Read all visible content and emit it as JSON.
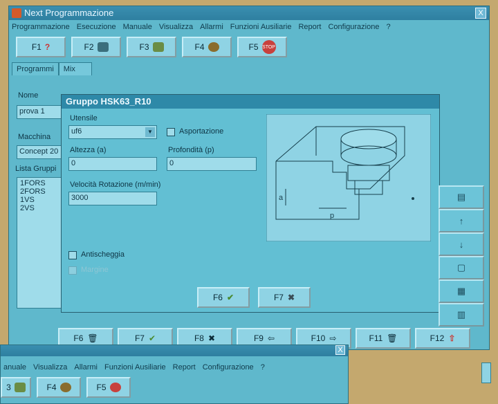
{
  "window": {
    "title": "Next Programmazione",
    "close_label": "X"
  },
  "menu": [
    "Programmazione",
    "Esecuzione",
    "Manuale",
    "Visualizza",
    "Allarmi",
    "Funzioni Ausiliarie",
    "Report",
    "Configurazione",
    "?"
  ],
  "fkeys": [
    {
      "label": "F1",
      "icon": "help-icon"
    },
    {
      "label": "F2",
      "icon": "machine-icon"
    },
    {
      "label": "F3",
      "icon": "tool-icon"
    },
    {
      "label": "F4",
      "icon": "alarm-clock-icon"
    },
    {
      "label": "F5",
      "icon": "stop-icon",
      "icon_text": "STOP"
    }
  ],
  "tabs": [
    "Programmi",
    "Mix"
  ],
  "left": {
    "nome_label": "Nome",
    "nome_value": "prova 1",
    "macchina_label": "Macchina",
    "macchina_value": "Concept 20",
    "lista_label": "Lista Gruppi",
    "gruppi": [
      "1FORS",
      "2FORS",
      "1VS",
      "2VS"
    ]
  },
  "dialog": {
    "title": "Gruppo HSK63_R10",
    "utensile_label": "Utensile",
    "utensile_value": "uf6",
    "asportazione_label": "Asportazione",
    "altezza_label": "Altezza (a)",
    "altezza_value": "0",
    "profondita_label": "Profondità (p)",
    "profondita_value": "0",
    "velocita_label": "Velocità Rotazione (m/min)",
    "velocita_value": "3000",
    "antischeggia_label": "Antischeggia",
    "disabled_label": "Margine",
    "diagram_a": "a",
    "diagram_p": "p",
    "ok_label": "F6",
    "cancel_label": "F7"
  },
  "bottom": [
    "F6",
    "F7",
    "F8",
    "F9",
    "F10",
    "F11",
    "F12"
  ],
  "second_window": {
    "menu": [
      "anuale",
      "Visualizza",
      "Allarmi",
      "Funzioni Ausiliarie",
      "Report",
      "Configurazione",
      "?"
    ],
    "fkeys": [
      "3",
      "F4",
      "F5"
    ],
    "close_label": "X"
  }
}
